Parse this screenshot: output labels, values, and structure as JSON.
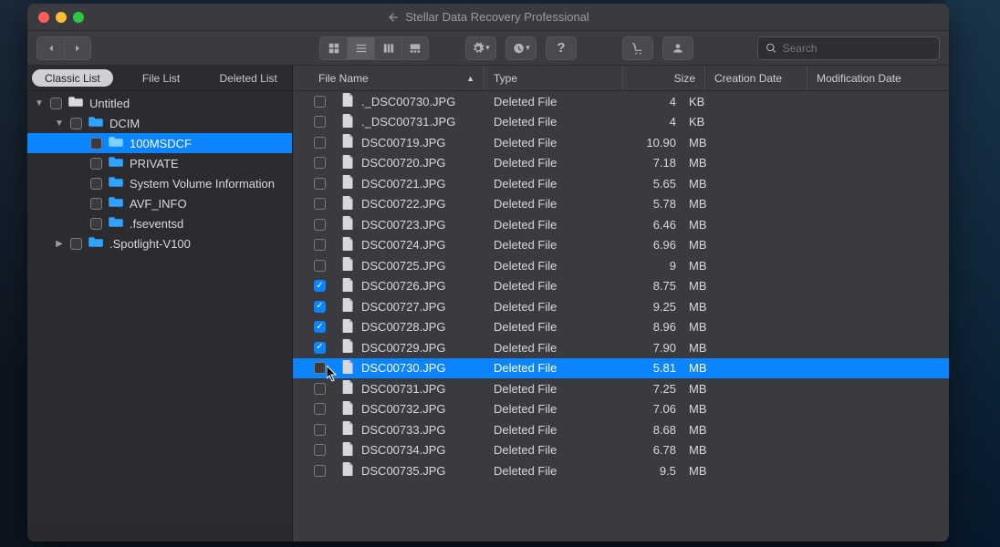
{
  "title": "Stellar Data Recovery Professional",
  "search_placeholder": "Search",
  "side_tabs": {
    "classic": "Classic List",
    "file": "File List",
    "deleted": "Deleted List"
  },
  "columns": {
    "name": "File Name",
    "type": "Type",
    "size": "Size",
    "cdate": "Creation Date",
    "mdate": "Modification Date"
  },
  "colors": {
    "accent": "#0a84ff"
  },
  "tree": [
    {
      "indent": 0,
      "disclosure": "▼",
      "checked": false,
      "folder_color": "#d9d9df",
      "label": "Untitled"
    },
    {
      "indent": 1,
      "disclosure": "▼",
      "checked": false,
      "folder_color": "#2ea3ff",
      "label": "DCIM"
    },
    {
      "indent": 2,
      "disclosure": "",
      "checked": false,
      "folder_color": "#7fd2ff",
      "label": "100MSDCF",
      "selected": true
    },
    {
      "indent": 2,
      "disclosure": "",
      "checked": false,
      "folder_color": "#2ea3ff",
      "label": "PRIVATE"
    },
    {
      "indent": 2,
      "disclosure": "",
      "checked": false,
      "folder_color": "#2ea3ff",
      "label": "System Volume Information"
    },
    {
      "indent": 2,
      "disclosure": "",
      "checked": false,
      "folder_color": "#2ea3ff",
      "label": "AVF_INFO"
    },
    {
      "indent": 2,
      "disclosure": "",
      "checked": false,
      "folder_color": "#2ea3ff",
      "label": ".fseventsd"
    },
    {
      "indent": 1,
      "disclosure": "▶",
      "checked": false,
      "folder_color": "#2ea3ff",
      "label": ".Spotlight-V100"
    }
  ],
  "files": [
    {
      "checked": false,
      "name": "._DSC00730.JPG",
      "type": "Deleted File",
      "size": "4",
      "unit": "KB"
    },
    {
      "checked": false,
      "name": "._DSC00731.JPG",
      "type": "Deleted File",
      "size": "4",
      "unit": "KB"
    },
    {
      "checked": false,
      "name": "DSC00719.JPG",
      "type": "Deleted File",
      "size": "10.90",
      "unit": "MB"
    },
    {
      "checked": false,
      "name": "DSC00720.JPG",
      "type": "Deleted File",
      "size": "7.18",
      "unit": "MB"
    },
    {
      "checked": false,
      "name": "DSC00721.JPG",
      "type": "Deleted File",
      "size": "5.65",
      "unit": "MB"
    },
    {
      "checked": false,
      "name": "DSC00722.JPG",
      "type": "Deleted File",
      "size": "5.78",
      "unit": "MB"
    },
    {
      "checked": false,
      "name": "DSC00723.JPG",
      "type": "Deleted File",
      "size": "6.46",
      "unit": "MB"
    },
    {
      "checked": false,
      "name": "DSC00724.JPG",
      "type": "Deleted File",
      "size": "6.96",
      "unit": "MB"
    },
    {
      "checked": false,
      "name": "DSC00725.JPG",
      "type": "Deleted File",
      "size": "9",
      "unit": "MB"
    },
    {
      "checked": true,
      "name": "DSC00726.JPG",
      "type": "Deleted File",
      "size": "8.75",
      "unit": "MB"
    },
    {
      "checked": true,
      "name": "DSC00727.JPG",
      "type": "Deleted File",
      "size": "9.25",
      "unit": "MB"
    },
    {
      "checked": true,
      "name": "DSC00728.JPG",
      "type": "Deleted File",
      "size": "8.96",
      "unit": "MB"
    },
    {
      "checked": true,
      "name": "DSC00729.JPG",
      "type": "Deleted File",
      "size": "7.90",
      "unit": "MB"
    },
    {
      "checked": false,
      "name": "DSC00730.JPG",
      "type": "Deleted File",
      "size": "5.81",
      "unit": "MB",
      "selected": true
    },
    {
      "checked": false,
      "name": "DSC00731.JPG",
      "type": "Deleted File",
      "size": "7.25",
      "unit": "MB"
    },
    {
      "checked": false,
      "name": "DSC00732.JPG",
      "type": "Deleted File",
      "size": "7.06",
      "unit": "MB"
    },
    {
      "checked": false,
      "name": "DSC00733.JPG",
      "type": "Deleted File",
      "size": "8.68",
      "unit": "MB"
    },
    {
      "checked": false,
      "name": "DSC00734.JPG",
      "type": "Deleted File",
      "size": "6.78",
      "unit": "MB"
    },
    {
      "checked": false,
      "name": "DSC00735.JPG",
      "type": "Deleted File",
      "size": "9.5",
      "unit": "MB"
    }
  ]
}
